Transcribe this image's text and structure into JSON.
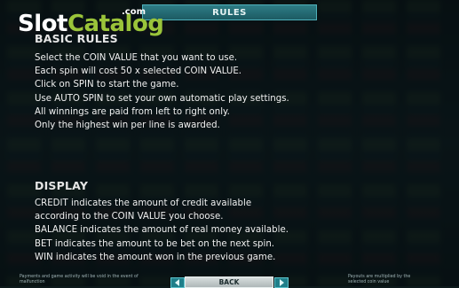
{
  "header": {
    "title": "RULES",
    "logo": {
      "main": "SlotCatalog",
      "part1": "Slot",
      "part2": "Catalog",
      "suffix": ".com"
    }
  },
  "basic_rules": {
    "heading": "BASIC RULES",
    "lines": [
      "Select the COIN VALUE that you want to use.",
      "Each spin will cost 50 x selected COIN VALUE.",
      "Click on SPIN to start the game.",
      "Use AUTO SPIN to set your own automatic play settings.",
      "All winnings are paid from left to right only.",
      "Only the highest win per line is awarded."
    ]
  },
  "display": {
    "heading": "DISPLAY",
    "lines": [
      "CREDIT indicates the amount of credit available",
      "according to the COIN VALUE you choose.",
      "BALANCE indicates the amount of real money available.",
      "BET indicates the amount to be bet on the next spin.",
      "WIN indicates the amount won in the previous game."
    ]
  },
  "footer": {
    "left_note": "Payments and game activity will be void in the event of malfunction",
    "right_note": "Payouts are multiplied by the selected coin value",
    "back_label": "BACK",
    "prev_icon": "arrow-left-icon",
    "next_icon": "arrow-right-icon"
  },
  "colors": {
    "accent": "#2e7d86",
    "logo_green": "#9ac43a",
    "text": "#f0f0f0"
  }
}
